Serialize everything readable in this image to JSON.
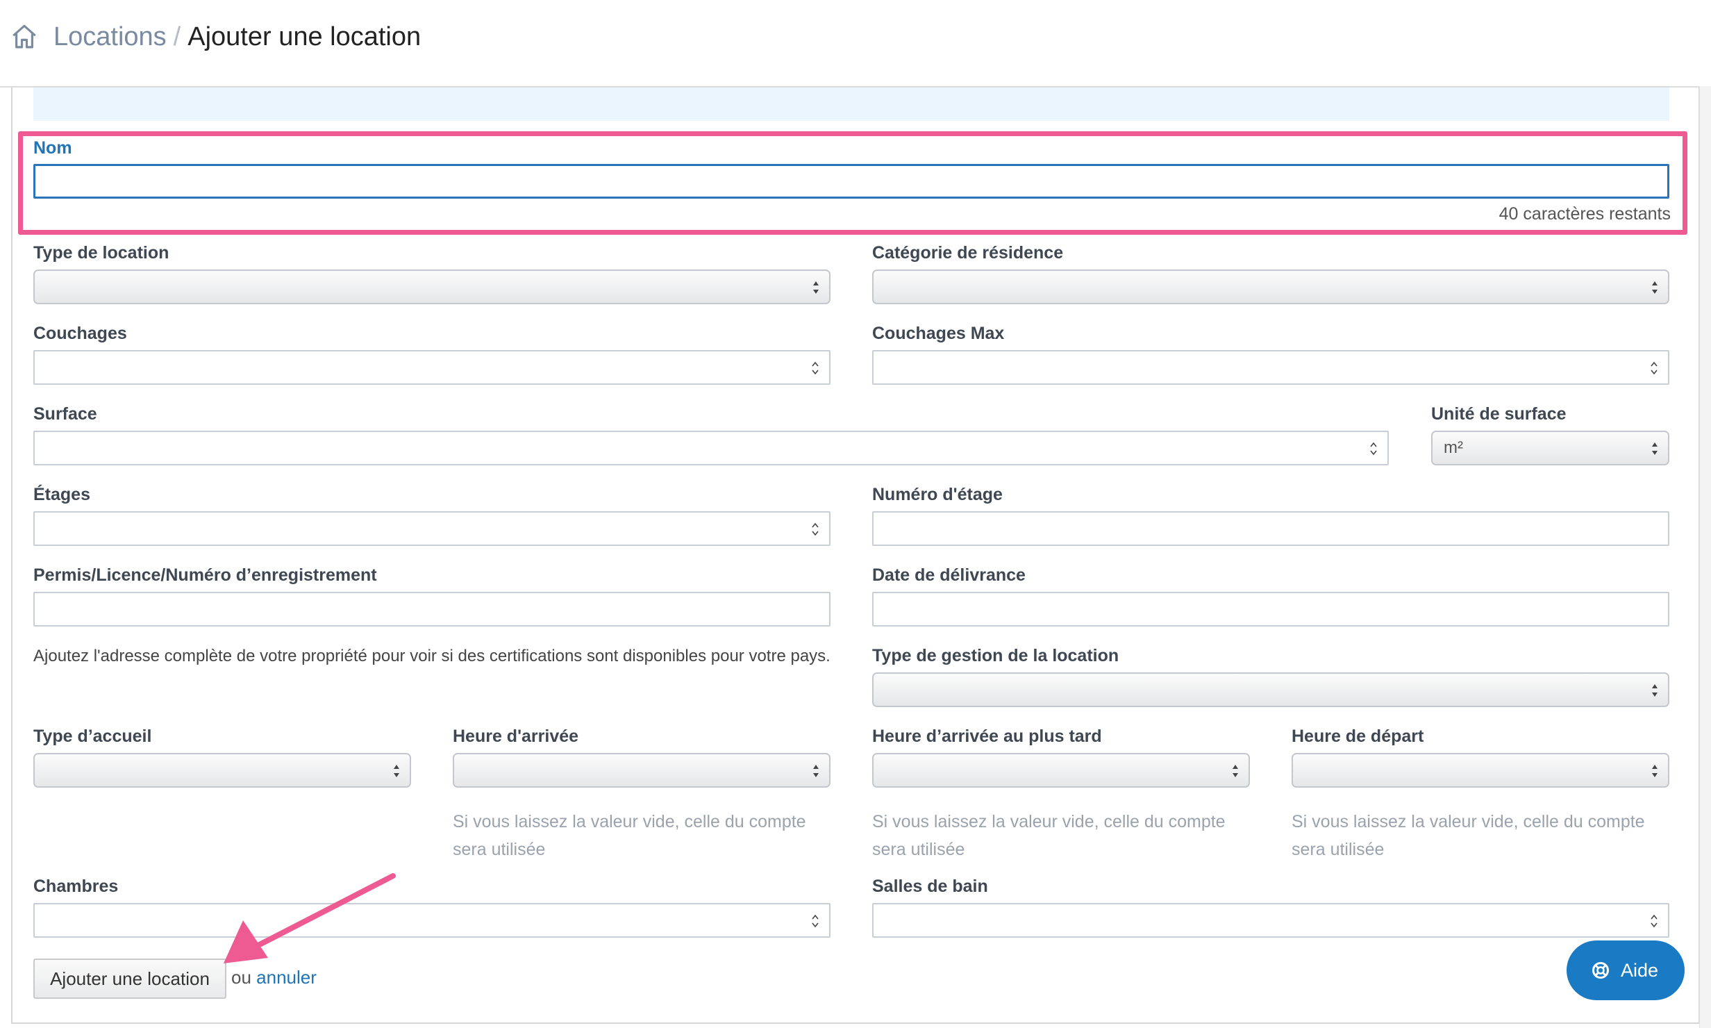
{
  "breadcrumb": {
    "home_icon": "home-icon",
    "parent": "Locations",
    "separator": "/",
    "current": "Ajouter une location"
  },
  "form": {
    "nom": {
      "label": "Nom",
      "value": "",
      "counter": "40 caractères restants"
    },
    "type_location": {
      "label": "Type de location",
      "value": ""
    },
    "categorie_residence": {
      "label": "Catégorie de résidence",
      "value": ""
    },
    "couchages": {
      "label": "Couchages",
      "value": ""
    },
    "couchages_max": {
      "label": "Couchages Max",
      "value": ""
    },
    "surface": {
      "label": "Surface",
      "value": ""
    },
    "unite_surface": {
      "label": "Unité de surface",
      "value": "m²"
    },
    "etages": {
      "label": "Étages",
      "value": ""
    },
    "numero_etage": {
      "label": "Numéro d'étage",
      "value": ""
    },
    "permis": {
      "label": "Permis/Licence/Numéro d’enregistrement",
      "value": ""
    },
    "date_delivrance": {
      "label": "Date de délivrance",
      "value": ""
    },
    "address_note": "Ajoutez l'adresse complète de votre propriété pour voir si des certifications sont disponibles pour votre pays.",
    "type_gestion": {
      "label": "Type de gestion de la location",
      "value": ""
    },
    "type_accueil": {
      "label": "Type d’accueil",
      "value": ""
    },
    "heure_arrivee": {
      "label": "Heure d'arrivée",
      "value": "",
      "help1": "Si vous laissez la valeur vide, celle du compte",
      "help2": "sera utilisée"
    },
    "heure_arrivee_tard": {
      "label": "Heure d’arrivée au plus tard",
      "value": "",
      "help1": "Si vous laissez la valeur vide, celle du compte",
      "help2": "sera utilisée"
    },
    "heure_depart": {
      "label": "Heure de départ",
      "value": "",
      "help1": "Si vous laissez la valeur vide, celle du compte",
      "help2": "sera utilisée"
    },
    "chambres": {
      "label": "Chambres",
      "value": ""
    },
    "salles_bain": {
      "label": "Salles de bain",
      "value": ""
    }
  },
  "actions": {
    "submit": "Ajouter une location",
    "or": "ou",
    "cancel": "annuler"
  },
  "help_button": {
    "label": "Aide",
    "icon": "lifebuoy-icon"
  },
  "annotation": {
    "highlight_color": "#ee5b93",
    "arrow_color": "#ee5b93"
  },
  "colors": {
    "accent": "#2374b7",
    "help_button": "#1a7bc4"
  }
}
